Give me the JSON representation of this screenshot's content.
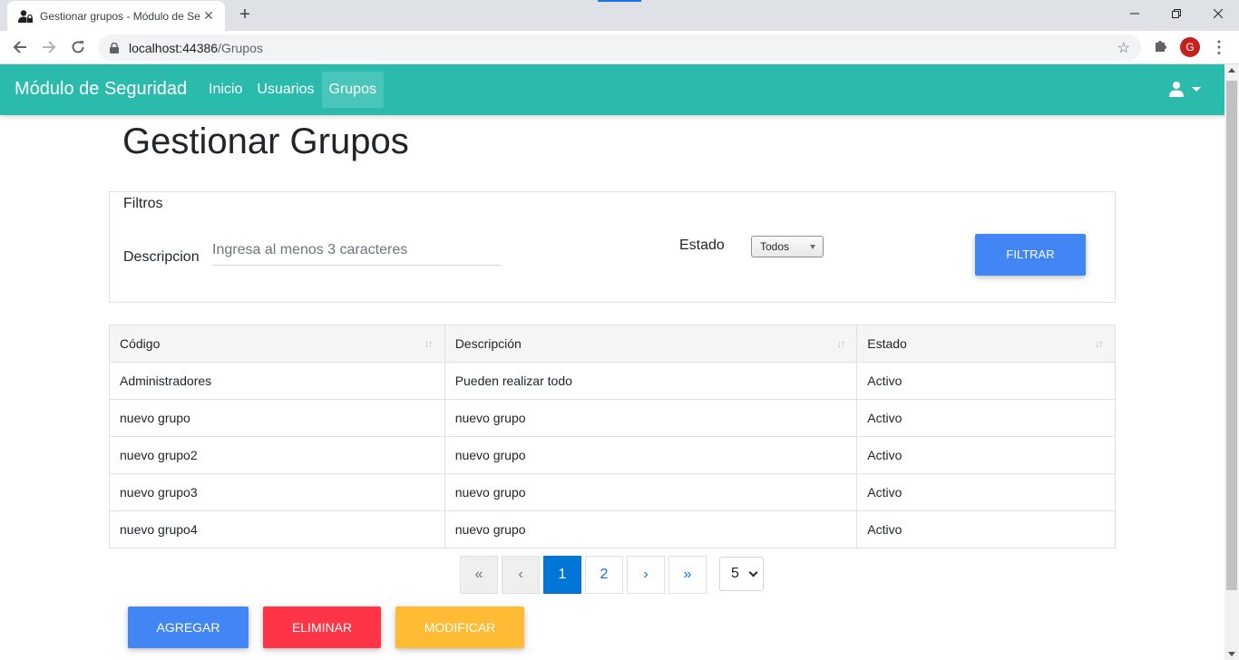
{
  "browser": {
    "tab_title": "Gestionar grupos - Módulo de Se",
    "url_host": "localhost:44386",
    "url_path": "/Grupos",
    "profile_initial": "G"
  },
  "navbar": {
    "brand": "Módulo de Seguridad",
    "links": [
      {
        "label": "Inicio"
      },
      {
        "label": "Usuarios"
      },
      {
        "label": "Grupos"
      }
    ],
    "color": "#2bbbad"
  },
  "page": {
    "title": "Gestionar Grupos"
  },
  "filters": {
    "title": "Filtros",
    "description_label": "Descripcion",
    "description_placeholder": "Ingresa al menos 3 caracteres",
    "description_value": "",
    "state_label": "Estado",
    "state_selected": "Todos",
    "filter_button": "FILTRAR"
  },
  "table": {
    "columns": [
      "Código",
      "Descripción",
      "Estado"
    ],
    "rows": [
      [
        "Administradores",
        "Pueden realizar todo",
        "Activo"
      ],
      [
        "nuevo grupo",
        "nuevo grupo",
        "Activo"
      ],
      [
        "nuevo grupo2",
        "nuevo grupo",
        "Activo"
      ],
      [
        "nuevo grupo3",
        "nuevo grupo",
        "Activo"
      ],
      [
        "nuevo grupo4",
        "nuevo grupo",
        "Activo"
      ]
    ]
  },
  "pagination": {
    "first": "«",
    "prev": "‹",
    "pages": [
      "1",
      "2"
    ],
    "current_page": "1",
    "next": "›",
    "last": "»",
    "page_size": "5"
  },
  "actions": {
    "add": "AGREGAR",
    "delete": "ELIMINAR",
    "modify": "MODIFICAR"
  },
  "colors": {
    "primary": "#4285f4",
    "danger": "#ff3547",
    "warning": "#ffbb33",
    "active_page": "#0275d8"
  }
}
